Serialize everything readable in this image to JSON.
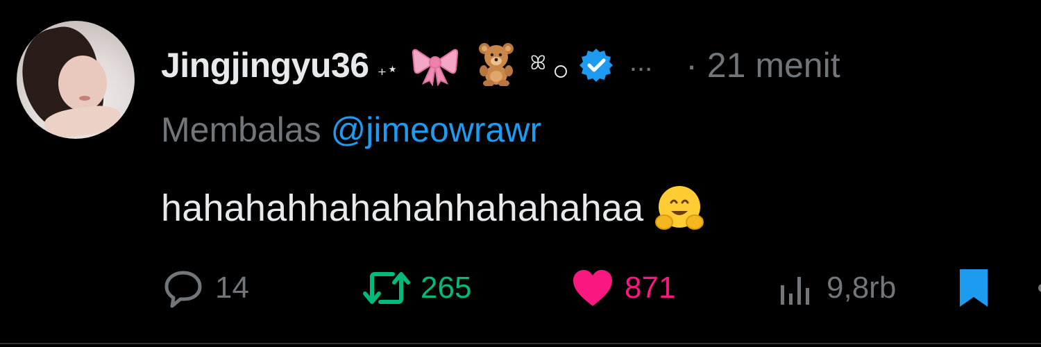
{
  "tweet": {
    "author": {
      "display_name": "Jingjingyu36",
      "name_decor_sparkle": "₊⋆",
      "name_decor_curls": "ꕤ",
      "verified": true
    },
    "time_ago": "· 21 menit",
    "more_label": "...",
    "reply_prefix": "Membalas",
    "reply_handle": "@jimeowrawr",
    "text": "hahahahhahahahhahahahaa",
    "emoji_icon": "hugging-face-icon",
    "actions": {
      "replies": "14",
      "retweets": "265",
      "likes": "871",
      "views": "9,8rb",
      "bookmarked": true
    }
  },
  "colors": {
    "background": "#000000",
    "text": "#e7e9ea",
    "muted": "#71767b",
    "link": "#1d9bf0",
    "retweet": "#00ba7c",
    "like": "#f91880",
    "bookmark": "#1d9bf0"
  }
}
